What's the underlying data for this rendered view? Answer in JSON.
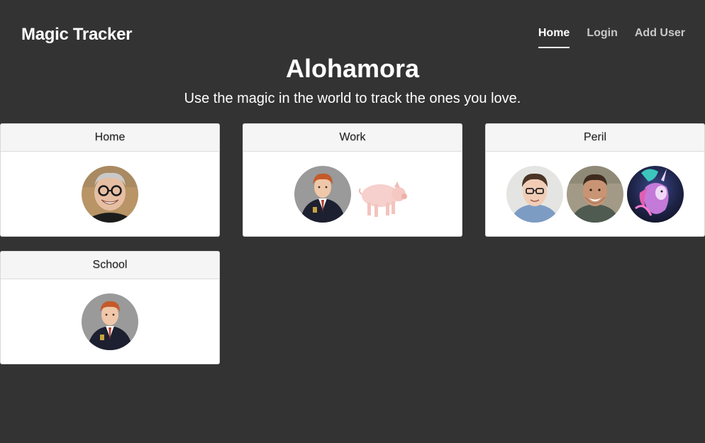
{
  "header": {
    "brand": "Magic Tracker",
    "nav": [
      {
        "label": "Home",
        "active": true
      },
      {
        "label": "Login",
        "active": false
      },
      {
        "label": "Add User",
        "active": false
      }
    ]
  },
  "hero": {
    "title": "Alohamora",
    "subtitle": "Use the magic in the world to track the ones you love."
  },
  "locations": [
    {
      "name": "Home",
      "members": [
        "old-man-glasses-avatar"
      ]
    },
    {
      "name": "Work",
      "members": [
        "red-haired-boy-avatar",
        "pig-avatar"
      ]
    },
    {
      "name": "Peril",
      "members": [
        "man-glasses-avatar",
        "man-smiling-avatar",
        "unicorn-avatar"
      ]
    },
    {
      "name": "School",
      "members": [
        "red-haired-boy-avatar"
      ]
    }
  ],
  "colors": {
    "background": "#333333",
    "card_header": "#f5f5f5",
    "card_body": "#ffffff",
    "nav_inactive": "#c9c9c9",
    "nav_active": "#ffffff"
  }
}
